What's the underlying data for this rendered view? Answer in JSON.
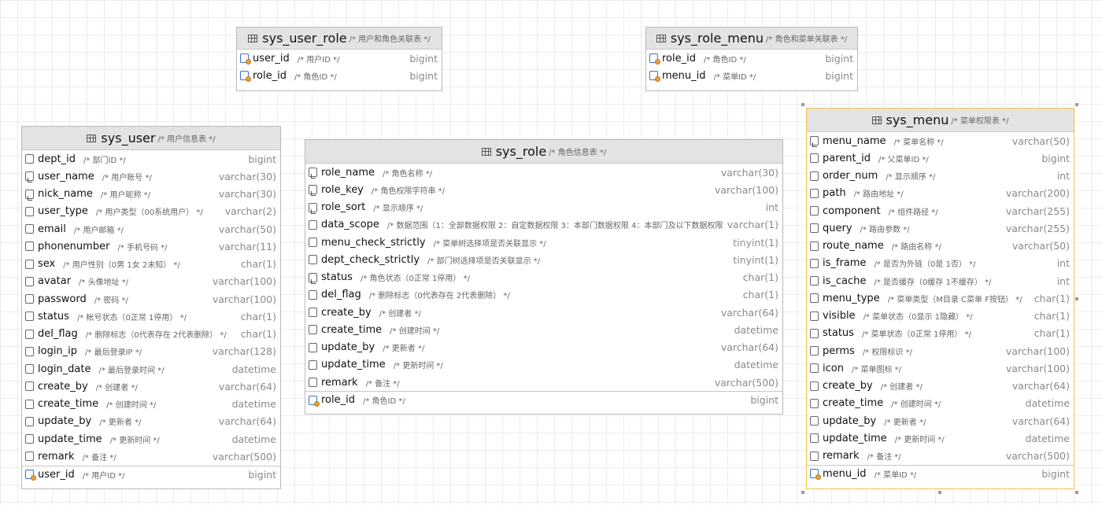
{
  "tables": {
    "sys_user_role": {
      "name": "sys_user_role",
      "comment": "/* 用户和角色关联表 */",
      "columns": [
        {
          "name": "user_id",
          "comment": "/* 用户ID */",
          "type": "bigint",
          "icon": "key-column-icon"
        },
        {
          "name": "role_id",
          "comment": "/* 角色ID */",
          "type": "bigint",
          "icon": "key-column-icon"
        }
      ]
    },
    "sys_role_menu": {
      "name": "sys_role_menu",
      "comment": "/* 角色和菜单关联表 */",
      "columns": [
        {
          "name": "role_id",
          "comment": "/* 角色ID */",
          "type": "bigint",
          "icon": "key-column-icon"
        },
        {
          "name": "menu_id",
          "comment": "/* 菜单ID */",
          "type": "bigint",
          "icon": "key-column-icon"
        }
      ]
    },
    "sys_user": {
      "name": "sys_user",
      "comment": "/* 用户信息表 */",
      "columns": [
        {
          "name": "dept_id",
          "comment": "/* 部门ID */",
          "type": "bigint",
          "icon": "column-icon"
        },
        {
          "name": "user_name",
          "comment": "/* 用户账号 */",
          "type": "varchar(30)",
          "icon": "indexed-column-icon"
        },
        {
          "name": "nick_name",
          "comment": "/* 用户昵称 */",
          "type": "varchar(30)",
          "icon": "indexed-column-icon"
        },
        {
          "name": "user_type",
          "comment": "/* 用户类型（00系统用户） */",
          "type": "varchar(2)",
          "icon": "column-icon"
        },
        {
          "name": "email",
          "comment": "/* 用户邮箱 */",
          "type": "varchar(50)",
          "icon": "column-icon"
        },
        {
          "name": "phonenumber",
          "comment": "/* 手机号码 */",
          "type": "varchar(11)",
          "icon": "column-icon"
        },
        {
          "name": "sex",
          "comment": "/* 用户性别（0男 1女 2未知） */",
          "type": "char(1)",
          "icon": "column-icon"
        },
        {
          "name": "avatar",
          "comment": "/* 头像地址 */",
          "type": "varchar(100)",
          "icon": "column-icon"
        },
        {
          "name": "password",
          "comment": "/* 密码 */",
          "type": "varchar(100)",
          "icon": "column-icon"
        },
        {
          "name": "status",
          "comment": "/* 帐号状态（0正常 1停用） */",
          "type": "char(1)",
          "icon": "column-icon"
        },
        {
          "name": "del_flag",
          "comment": "/* 删除标志（0代表存在 2代表删除） */",
          "type": "char(1)",
          "icon": "column-icon"
        },
        {
          "name": "login_ip",
          "comment": "/* 最后登录IP */",
          "type": "varchar(128)",
          "icon": "column-icon"
        },
        {
          "name": "login_date",
          "comment": "/* 最后登录时间 */",
          "type": "datetime",
          "icon": "column-icon"
        },
        {
          "name": "create_by",
          "comment": "/* 创建者 */",
          "type": "varchar(64)",
          "icon": "column-icon"
        },
        {
          "name": "create_time",
          "comment": "/* 创建时间 */",
          "type": "datetime",
          "icon": "column-icon"
        },
        {
          "name": "update_by",
          "comment": "/* 更新者 */",
          "type": "varchar(64)",
          "icon": "column-icon"
        },
        {
          "name": "update_time",
          "comment": "/* 更新时间 */",
          "type": "datetime",
          "icon": "column-icon"
        },
        {
          "name": "remark",
          "comment": "/* 备注 */",
          "type": "varchar(500)",
          "icon": "column-icon"
        }
      ],
      "pk": {
        "name": "user_id",
        "comment": "/* 用户ID */",
        "type": "bigint",
        "icon": "key-column-icon"
      }
    },
    "sys_role": {
      "name": "sys_role",
      "comment": "/* 角色信息表 */",
      "columns": [
        {
          "name": "role_name",
          "comment": "/* 角色名称 */",
          "type": "varchar(30)",
          "icon": "indexed-column-icon"
        },
        {
          "name": "role_key",
          "comment": "/* 角色权限字符串 */",
          "type": "varchar(100)",
          "icon": "indexed-column-icon"
        },
        {
          "name": "role_sort",
          "comment": "/* 显示顺序 */",
          "type": "int",
          "icon": "indexed-column-icon"
        },
        {
          "name": "data_scope",
          "comment": "/* 数据范围（1：全部数据权限 2：自定数据权限 3：本部门数据权限 4：本部门及以下数据权限） */",
          "type": "varchar(1)",
          "icon": "column-icon"
        },
        {
          "name": "menu_check_strictly",
          "comment": "/* 菜单树选择项是否关联显示 */",
          "type": "tinyint(1)",
          "icon": "column-icon"
        },
        {
          "name": "dept_check_strictly",
          "comment": "/* 部门树选择项是否关联显示 */",
          "type": "tinyint(1)",
          "icon": "column-icon"
        },
        {
          "name": "status",
          "comment": "/* 角色状态（0正常 1停用） */",
          "type": "char(1)",
          "icon": "indexed-column-icon"
        },
        {
          "name": "del_flag",
          "comment": "/* 删除标志（0代表存在 2代表删除） */",
          "type": "char(1)",
          "icon": "column-icon"
        },
        {
          "name": "create_by",
          "comment": "/* 创建者 */",
          "type": "varchar(64)",
          "icon": "column-icon"
        },
        {
          "name": "create_time",
          "comment": "/* 创建时间 */",
          "type": "datetime",
          "icon": "column-icon"
        },
        {
          "name": "update_by",
          "comment": "/* 更新者 */",
          "type": "varchar(64)",
          "icon": "column-icon"
        },
        {
          "name": "update_time",
          "comment": "/* 更新时间 */",
          "type": "datetime",
          "icon": "column-icon"
        },
        {
          "name": "remark",
          "comment": "/* 备注 */",
          "type": "varchar(500)",
          "icon": "column-icon"
        }
      ],
      "pk": {
        "name": "role_id",
        "comment": "/* 角色ID */",
        "type": "bigint",
        "icon": "key-column-icon"
      }
    },
    "sys_menu": {
      "name": "sys_menu",
      "comment": "/* 菜单权限表 */",
      "columns": [
        {
          "name": "menu_name",
          "comment": "/* 菜单名称 */",
          "type": "varchar(50)",
          "icon": "indexed-column-icon"
        },
        {
          "name": "parent_id",
          "comment": "/* 父菜单ID */",
          "type": "bigint",
          "icon": "column-icon"
        },
        {
          "name": "order_num",
          "comment": "/* 显示顺序 */",
          "type": "int",
          "icon": "column-icon"
        },
        {
          "name": "path",
          "comment": "/* 路由地址 */",
          "type": "varchar(200)",
          "icon": "column-icon"
        },
        {
          "name": "component",
          "comment": "/* 组件路径 */",
          "type": "varchar(255)",
          "icon": "column-icon"
        },
        {
          "name": "query",
          "comment": "/* 路由参数 */",
          "type": "varchar(255)",
          "icon": "column-icon"
        },
        {
          "name": "route_name",
          "comment": "/* 路由名称 */",
          "type": "varchar(50)",
          "icon": "column-icon"
        },
        {
          "name": "is_frame",
          "comment": "/* 是否为外链（0是 1否） */",
          "type": "int",
          "icon": "column-icon"
        },
        {
          "name": "is_cache",
          "comment": "/* 是否缓存（0缓存 1不缓存） */",
          "type": "int",
          "icon": "column-icon"
        },
        {
          "name": "menu_type",
          "comment": "/* 菜单类型（M目录 C菜单 F按钮） */",
          "type": "char(1)",
          "icon": "column-icon"
        },
        {
          "name": "visible",
          "comment": "/* 菜单状态（0显示 1隐藏） */",
          "type": "char(1)",
          "icon": "column-icon"
        },
        {
          "name": "status",
          "comment": "/* 菜单状态（0正常 1停用） */",
          "type": "char(1)",
          "icon": "column-icon"
        },
        {
          "name": "perms",
          "comment": "/* 权限标识 */",
          "type": "varchar(100)",
          "icon": "column-icon"
        },
        {
          "name": "icon",
          "comment": "/* 菜单图标 */",
          "type": "varchar(100)",
          "icon": "column-icon"
        },
        {
          "name": "create_by",
          "comment": "/* 创建者 */",
          "type": "varchar(64)",
          "icon": "column-icon"
        },
        {
          "name": "create_time",
          "comment": "/* 创建时间 */",
          "type": "datetime",
          "icon": "column-icon"
        },
        {
          "name": "update_by",
          "comment": "/* 更新者 */",
          "type": "varchar(64)",
          "icon": "column-icon"
        },
        {
          "name": "update_time",
          "comment": "/* 更新时间 */",
          "type": "datetime",
          "icon": "column-icon"
        },
        {
          "name": "remark",
          "comment": "/* 备注 */",
          "type": "varchar(500)",
          "icon": "column-icon"
        }
      ],
      "pk": {
        "name": "menu_id",
        "comment": "/* 菜单ID */",
        "type": "bigint",
        "icon": "key-column-icon"
      }
    }
  }
}
